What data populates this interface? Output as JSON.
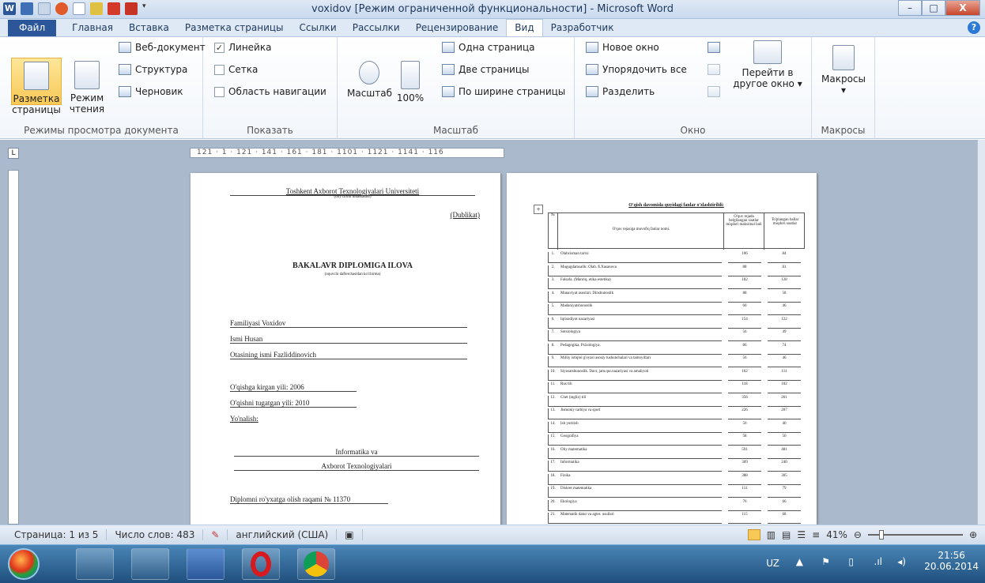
{
  "window": {
    "title": "voxidov [Режим ограниченной функциональности] - Microsoft Word",
    "minimize": "–",
    "maximize": "□",
    "close": "X"
  },
  "tabs": [
    "Файл",
    "Главная",
    "Вставка",
    "Разметка страницы",
    "Ссылки",
    "Рассылки",
    "Рецензирование",
    "Вид",
    "Разработчик"
  ],
  "ribbon": {
    "views": {
      "layout": "Разметка страницы",
      "reading": "Режим чтения",
      "web": "Веб-документ",
      "outline": "Структура",
      "draft": "Черновик",
      "label": "Режимы просмотра документа"
    },
    "show": {
      "ruler": "Линейка",
      "grid": "Сетка",
      "nav": "Область навигации",
      "label": "Показать",
      "ruler_checked": true,
      "grid_checked": false,
      "nav_checked": false
    },
    "zoom": {
      "zoom": "Масштаб",
      "p100": "100%",
      "one": "Одна страница",
      "two": "Две страницы",
      "width": "По ширине страницы",
      "label": "Масштаб"
    },
    "window": {
      "new": "Новое окно",
      "arrange": "Упорядочить все",
      "split": "Разделить",
      "switch": "Перейти в другое окно",
      "label": "Окно"
    },
    "macros": {
      "btn": "Макросы",
      "label": "Макросы"
    }
  },
  "ruler": {
    "h": "121 · 1 · 121 · 141 · 161 · 181 · 1101 · 1121 · 1141 · 116"
  },
  "page1": {
    "uni": "Toshkent Axborot Texnologiyalari Universiteti",
    "uni_sub": "(oliy ta'lim muassasasi)",
    "dup": "(Dublikat)",
    "heading": "BAKALAVR DIPLOMIGA ILOVA",
    "heading_sub": "(oquvchi dafterchasidan ko'chirma)",
    "surname": "Familiyasi  Voxidov",
    "name": "Ismi    Husan",
    "patronym": "Otasining ismi  Fazliddinovich",
    "entry": "O'qishga kirgan yili:  2006",
    "finish": "O'qishni tugatgan yili:  2010",
    "direction": "Yo'nalish:",
    "dir1": "Informatika va",
    "dir2": "Axborot Texnologiyalari",
    "reg": "Diplomni ro'yxatga olish raqami №   11370"
  },
  "page2": {
    "title": "O'qish davomida quyidagi fanlar o'zlashtirildi:",
    "col_no": "№",
    "col_name": "O'quv rejasiga muvofiq fanlar nomi.",
    "col_hours": "O'quv rejada belgilangan soatlar miqdori maksimal bali",
    "col_score": "To'plangan ballar miqdori soatlar",
    "rows": [
      [
        "1.",
        "Olabcisman tarixi",
        "106",
        "84"
      ],
      [
        "2.",
        "Mugugdamsalik: Olab. ß.Xasanova",
        "88",
        "81"
      ],
      [
        "3.",
        "Falsafa. (Manriq, etika estetika)",
        "182",
        "128"
      ],
      [
        "4.",
        "Manaviyat asoslari. Dinshunoslik",
        "88",
        "58"
      ],
      [
        "5.",
        "Madaniyatshunoslik",
        "60",
        "46"
      ],
      [
        "6.",
        "Iqtisodiyot nazariyasi",
        "154",
        "122"
      ],
      [
        "7.",
        "Sotsiologiya",
        "56",
        "49"
      ],
      [
        "8.",
        "Pedagogika. Psixologiya.",
        "86",
        "74"
      ],
      [
        "9.",
        "Milliy istiqlol g'oyasi asosiy tushunchalari va tamoyillari",
        "56",
        "46"
      ],
      [
        "10.",
        "Siyosatshunoslik. Davr, jam.qur.nazariyasi va amaliyoti",
        "162",
        "111"
      ],
      [
        "11.",
        "Rus tili",
        "118",
        "102"
      ],
      [
        "12.",
        "Chet (ingliz) tili",
        "356",
        "261"
      ],
      [
        "13.",
        "Jismoniy tarbiya va sport",
        "226",
        "207"
      ],
      [
        "14.",
        "Ish yuritish",
        "56",
        "40"
      ],
      [
        "15.",
        "Geografiya",
        "58",
        "50"
      ],
      [
        "16.",
        "Oliy matematika",
        "591",
        "481"
      ],
      [
        "17.",
        "Informatika",
        "309",
        "240"
      ],
      [
        "18.",
        "Fizika",
        "388",
        "305"
      ],
      [
        "19.",
        "Diskret matematika",
        "111",
        "79"
      ],
      [
        "20.",
        "Ekologiya",
        "76",
        "66"
      ],
      [
        "21.",
        "Matematik datur va agter. usullari",
        "115",
        "68"
      ]
    ]
  },
  "status": {
    "page": "Страница: 1 из 5",
    "words": "Число слов: 483",
    "lang": "английский (США)",
    "zoom": "41%"
  },
  "tray": {
    "lang": "UZ",
    "time": "21:56",
    "date": "20.06.2014"
  }
}
